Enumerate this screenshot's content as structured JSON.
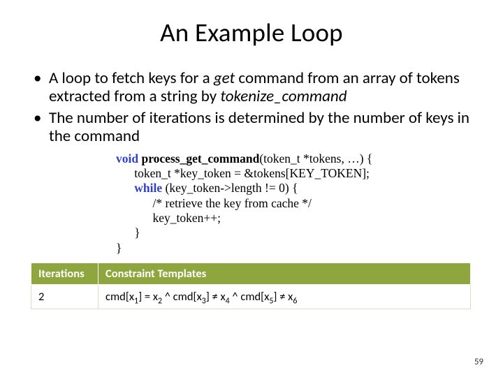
{
  "title": "An Example Loop",
  "bullets": [
    {
      "pre": "A loop to fetch keys for a ",
      "em1": "get",
      "mid": " command from an array of tokens extracted from a string by ",
      "em2": "tokenize_command",
      "post": ""
    },
    {
      "pre": "The number of iterations is determined by the number of keys in the command",
      "em1": "",
      "mid": "",
      "em2": "",
      "post": ""
    }
  ],
  "code": {
    "l1a": "void",
    "l1b": " ",
    "l1c": "process_get_command",
    "l1d": "(token_t *tokens, …) {",
    "l2a": "      token_t *key_token = &tokens[KEY_TOKEN];",
    "l3a": "      ",
    "l3b": "while",
    "l3c": " (key_token->length != 0) {",
    "l4a": "            /* retrieve the key from cache */",
    "l5a": "            key_token++;",
    "l6a": "      }",
    "l7a": "}"
  },
  "table": {
    "h1": "Iterations",
    "h2": "Constraint Templates",
    "r1c1": "2",
    "r1c2": {
      "p1": "cmd[x",
      "s1": "1",
      "p2": "] = x",
      "s2": "2",
      "p3": " ^ cmd[x",
      "s3": "3",
      "p4": "] ≠ x",
      "s4": "4",
      "p5": " ^ cmd[x",
      "s5": "5",
      "p6": "] ≠ x",
      "s6": "6"
    }
  },
  "pagenum": "59"
}
